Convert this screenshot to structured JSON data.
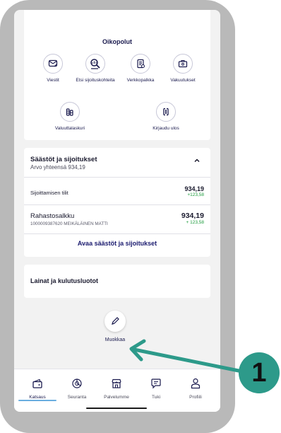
{
  "shortcuts": {
    "title": "Oikopolut",
    "items": [
      {
        "label": "Viestit",
        "icon": "message-icon"
      },
      {
        "label": "Etsi sijoituskohteita",
        "icon": "search-investments-icon"
      },
      {
        "label": "Verkkopalkka",
        "icon": "payslip-icon"
      },
      {
        "label": "Vakuutukset",
        "icon": "insurance-icon"
      },
      {
        "label": "Valuuttalaskuri",
        "icon": "currency-calculator-icon"
      },
      {
        "label": "Kirjaudu ulos",
        "icon": "logout-icon"
      }
    ]
  },
  "savings": {
    "title": "Säästöt ja sijoitukset",
    "subtitle": "Arvo yhteensä 934,19",
    "rows": [
      {
        "label": "Sijoittamisen tilit",
        "amount": "934,19",
        "delta": "+123,58"
      },
      {
        "label": "Rahastosalkku",
        "sublabel": "1000009387620 MEIKÄLÄINEN MATTI",
        "amount": "934,19",
        "delta": "+ 123,58"
      }
    ],
    "link": "Avaa säästöt ja sijoitukset"
  },
  "loans": {
    "title": "Lainat ja kulutusluotot"
  },
  "edit": {
    "label": "Muokkaa"
  },
  "tabbar": {
    "tabs": [
      {
        "label": "Katsaus",
        "icon": "wallet-icon",
        "active": true
      },
      {
        "label": "Seuranta",
        "icon": "chart-pie-icon",
        "active": false
      },
      {
        "label": "Palvelumme",
        "icon": "shop-icon",
        "active": false
      },
      {
        "label": "Tuki",
        "icon": "chat-icon",
        "active": false
      },
      {
        "label": "Profiili",
        "icon": "person-icon",
        "active": false
      }
    ]
  },
  "callout": {
    "number": "1"
  },
  "colors": {
    "accent": "#2d9a8a",
    "link": "#1a1a6e",
    "positive": "#1a9a3a",
    "active_tab": "#6aaee0"
  }
}
